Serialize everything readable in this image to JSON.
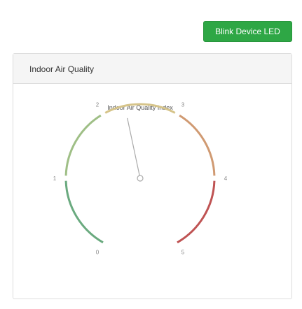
{
  "toolbar": {
    "blink_label": "Blink Device LED",
    "blink_color": "#2ea745"
  },
  "panel": {
    "title": "Indoor Air Quality"
  },
  "gauge": {
    "title": "Indoor Air Quality Index",
    "min": 0,
    "max": 5,
    "value": 2.3,
    "ticks": [
      "0",
      "1",
      "2",
      "3",
      "4",
      "5"
    ],
    "band_colors": [
      "#6aaa7f",
      "#9fbf86",
      "#d6c48a",
      "#d09a72",
      "#bf5353"
    ],
    "needle_color": "#aaaaaa"
  }
}
